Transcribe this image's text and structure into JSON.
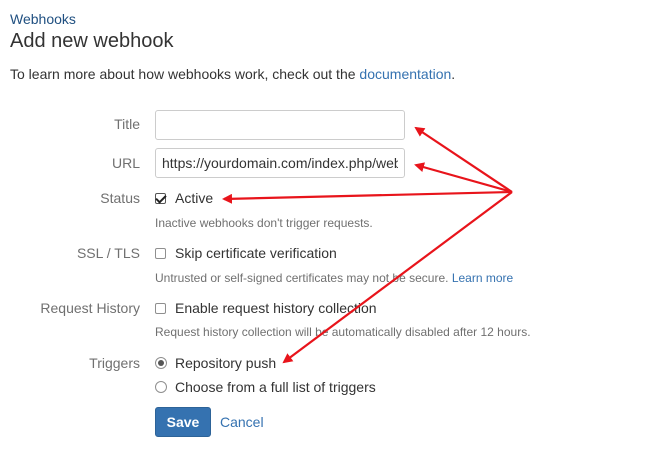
{
  "breadcrumb": {
    "label": "Webhooks"
  },
  "page": {
    "title": "Add new webhook"
  },
  "intro": {
    "text": "To learn more about how webhooks work, check out the ",
    "link": "documentation",
    "suffix": "."
  },
  "form": {
    "title": {
      "label": "Title",
      "value": ""
    },
    "url": {
      "label": "URL",
      "value": "https://yourdomain.com/index.php/web"
    },
    "status": {
      "label": "Status",
      "checkbox_label": "Active",
      "checked": true,
      "help": "Inactive webhooks don't trigger requests."
    },
    "ssl": {
      "label": "SSL / TLS",
      "checkbox_label": "Skip certificate verification",
      "checked": false,
      "help": "Untrusted or self-signed certificates may not be secure. ",
      "help_link": "Learn more"
    },
    "history": {
      "label": "Request History",
      "checkbox_label": "Enable request history collection",
      "checked": false,
      "help": "Request history collection will be automatically disabled after 12 hours."
    },
    "triggers": {
      "label": "Triggers",
      "options": [
        "Repository push",
        "Choose from a full list of triggers"
      ],
      "selected": "Repository push"
    },
    "save_label": "Save",
    "cancel_label": "Cancel"
  },
  "annotation": {
    "arrow_color": "#e8141b"
  }
}
